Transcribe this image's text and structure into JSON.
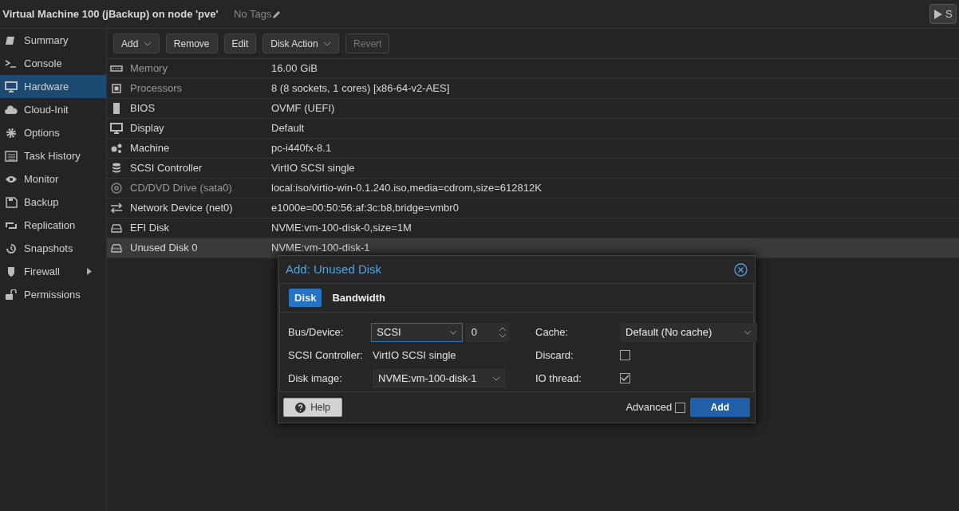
{
  "header": {
    "title": "Virtual Machine 100 (jBackup) on node 'pve'",
    "tags": "No Tags",
    "start_button": "S"
  },
  "sidebar": {
    "items": [
      {
        "label": "Summary",
        "selected": false
      },
      {
        "label": "Console",
        "selected": false
      },
      {
        "label": "Hardware",
        "selected": true
      },
      {
        "label": "Cloud-Init",
        "selected": false
      },
      {
        "label": "Options",
        "selected": false
      },
      {
        "label": "Task History",
        "selected": false
      },
      {
        "label": "Monitor",
        "selected": false
      },
      {
        "label": "Backup",
        "selected": false
      },
      {
        "label": "Replication",
        "selected": false
      },
      {
        "label": "Snapshots",
        "selected": false
      },
      {
        "label": "Firewall",
        "selected": false,
        "expandable": true
      },
      {
        "label": "Permissions",
        "selected": false
      }
    ]
  },
  "toolbar": [
    {
      "label": "Add",
      "dropdown": true,
      "disabled": false
    },
    {
      "label": "Remove",
      "dropdown": false,
      "disabled": false
    },
    {
      "label": "Edit",
      "dropdown": false,
      "disabled": false
    },
    {
      "label": "Disk Action",
      "dropdown": true,
      "disabled": false
    },
    {
      "label": "Revert",
      "dropdown": false,
      "disabled": true
    }
  ],
  "hardware": {
    "rows": [
      {
        "name": "Memory",
        "value": "16.00 GiB",
        "pending": true,
        "selected": false
      },
      {
        "name": "Processors",
        "value": "8 (8 sockets, 1 cores) [x86-64-v2-AES]",
        "pending": true,
        "selected": false
      },
      {
        "name": "BIOS",
        "value": "OVMF (UEFI)",
        "pending": false,
        "selected": false
      },
      {
        "name": "Display",
        "value": "Default",
        "pending": false,
        "selected": false
      },
      {
        "name": "Machine",
        "value": "pc-i440fx-8.1",
        "pending": false,
        "selected": false
      },
      {
        "name": "SCSI Controller",
        "value": "VirtIO SCSI single",
        "pending": false,
        "selected": false
      },
      {
        "name": "CD/DVD Drive (sata0)",
        "value": "local:iso/virtio-win-0.1.240.iso,media=cdrom,size=612812K",
        "pending": true,
        "selected": false
      },
      {
        "name": "Network Device (net0)",
        "value": "e1000e=00:50:56:af:3c:b8,bridge=vmbr0",
        "pending": false,
        "selected": false
      },
      {
        "name": "EFI Disk",
        "value": "NVME:vm-100-disk-0,size=1M",
        "pending": false,
        "selected": false
      },
      {
        "name": "Unused Disk 0",
        "value": "NVME:vm-100-disk-1",
        "pending": false,
        "selected": true
      }
    ]
  },
  "dialog": {
    "title": "Add: Unused Disk",
    "tabs": [
      {
        "label": "Disk",
        "selected": true
      },
      {
        "label": "Bandwidth",
        "selected": false
      }
    ],
    "left_fields": [
      {
        "kind": "select",
        "label": "Bus/Device:",
        "value": "SCSI",
        "focused": true,
        "number": "0"
      },
      {
        "kind": "display",
        "label": "SCSI Controller:",
        "value": "VirtIO SCSI single"
      },
      {
        "kind": "select",
        "label": "Disk image:",
        "value": "NVME:vm-100-disk-1",
        "focused": false
      }
    ],
    "right_fields": [
      {
        "kind": "select",
        "label": "Cache:",
        "value": "Default (No cache)",
        "focused": false
      },
      {
        "kind": "checkbox",
        "label": "Discard:",
        "checked": false
      },
      {
        "kind": "checkbox",
        "label": "IO thread:",
        "checked": true
      }
    ],
    "help_button": "Help",
    "advanced": {
      "label": "Advanced",
      "checked": false
    },
    "add_button": "Add"
  }
}
